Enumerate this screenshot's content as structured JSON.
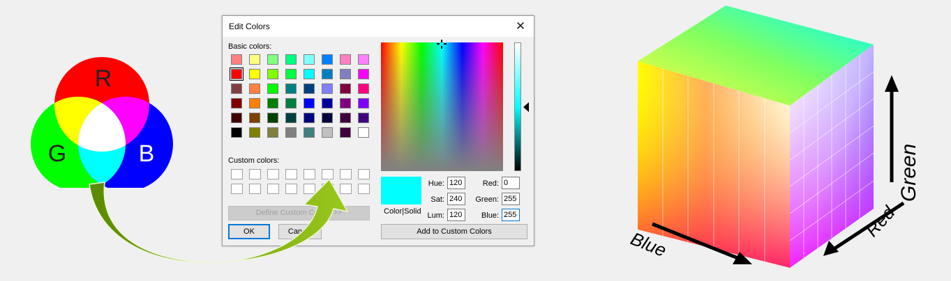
{
  "venn": {
    "labels": {
      "r": "R",
      "g": "G",
      "b": "B"
    },
    "colors": {
      "red": "#ff0000",
      "green": "#00ff00",
      "blue": "#0000ff",
      "yellow": "#ffff00",
      "magenta": "#ff00ff",
      "cyan": "#00ffff",
      "white": "#ffffff"
    }
  },
  "arrow": {
    "color_dark": "#5a8a00",
    "color_light": "#9ac81e"
  },
  "dialog": {
    "title": "Edit Colors",
    "close_glyph": "✕",
    "basic_colors_label": "Basic colors:",
    "custom_colors_label": "Custom colors:",
    "basic_colors": [
      [
        "#ff8080",
        "#ffff80",
        "#80ff80",
        "#00ff80",
        "#80ffff",
        "#0080ff",
        "#ff80c0",
        "#ff80ff"
      ],
      [
        "#ff0000",
        "#ffff00",
        "#80ff00",
        "#00ff40",
        "#00ffff",
        "#0080c0",
        "#8080c0",
        "#ff00ff"
      ],
      [
        "#804040",
        "#ff8040",
        "#00ff00",
        "#008080",
        "#004080",
        "#8080ff",
        "#800040",
        "#ff0080"
      ],
      [
        "#800000",
        "#ff8000",
        "#008000",
        "#008040",
        "#0000ff",
        "#0000a0",
        "#800080",
        "#8000ff"
      ],
      [
        "#400000",
        "#804000",
        "#004000",
        "#004040",
        "#000080",
        "#000040",
        "#400040",
        "#400080"
      ],
      [
        "#000000",
        "#808000",
        "#808040",
        "#808080",
        "#408080",
        "#c0c0c0",
        "#400040",
        "#ffffff"
      ]
    ],
    "custom_colors": [
      [
        "#ffffff",
        "#ffffff",
        "#ffffff",
        "#ffffff",
        "#ffffff",
        "#ffffff",
        "#ffffff",
        "#ffffff"
      ],
      [
        "#ffffff",
        "#ffffff",
        "#ffffff",
        "#ffffff",
        "#ffffff",
        "#ffffff",
        "#ffffff",
        "#ffffff"
      ]
    ],
    "define_button": "Define Custom Colors >>",
    "ok_button": "OK",
    "cancel_button": "Cancel",
    "preview_color": "#00ffff",
    "preview_label": "Color|Solid",
    "hue_label": "Hue:",
    "hue_value": "120",
    "sat_label": "Sat:",
    "sat_value": "240",
    "lum_label": "Lum:",
    "lum_value": "120",
    "red_label": "Red:",
    "red_value": "0",
    "green_label": "Green:",
    "green_value": "255",
    "blue_label": "Blue:",
    "blue_value": "255",
    "add_button": "Add to Custom Colors"
  },
  "cube": {
    "blue_label": "Blue",
    "red_label": "Red",
    "green_label": "Green"
  }
}
